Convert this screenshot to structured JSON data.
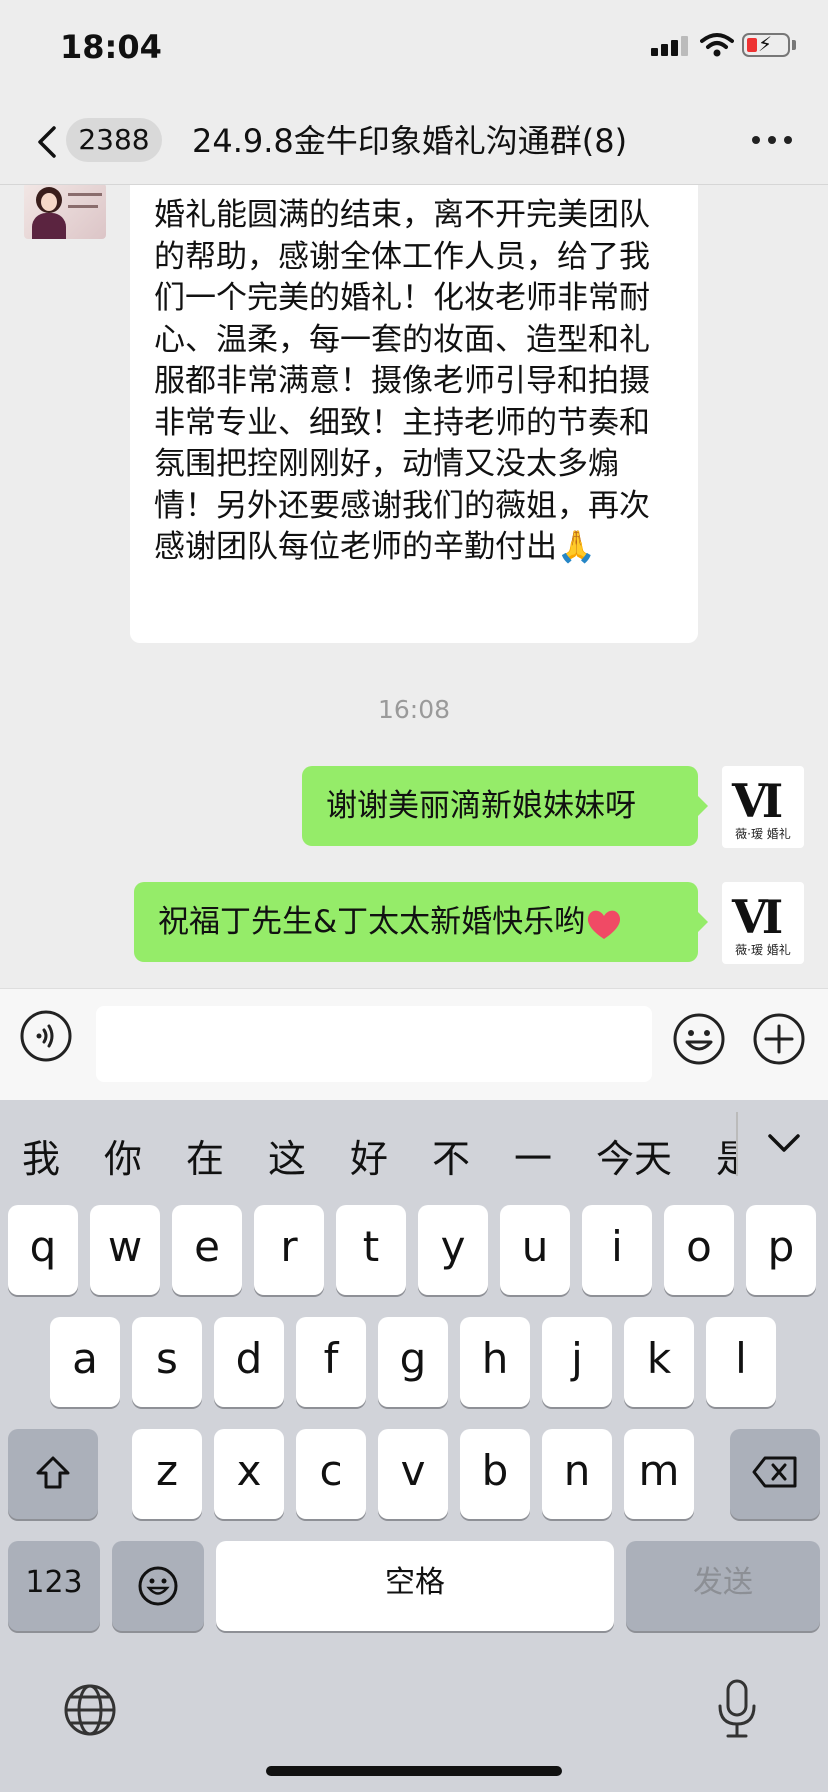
{
  "status_bar": {
    "time": "18:04"
  },
  "header": {
    "unread_count": "2388",
    "title": "24.9.8金牛印象婚礼沟通群(8)"
  },
  "messages": [
    {
      "direction": "in",
      "text": "婚礼能圆满的结束，离不开完美团队的帮助，感谢全体工作人员，给了我们一个完美的婚礼！化妆老师非常耐心、温柔，每一套的妆面、造型和礼服都非常满意！摄像老师引导和拍摄非常专业、细致！主持老师的节奏和氛围把控刚刚好，动情又没太多煽情！另外还要感谢我们的薇姐，再次感谢团队每位老师的辛勤付出🙏"
    },
    {
      "type": "timestamp",
      "text": "16:08"
    },
    {
      "direction": "out",
      "text": "谢谢美丽滴新娘妹妹呀"
    },
    {
      "direction": "out",
      "text": "祝福丁先生&丁太太新婚快乐哟"
    }
  ],
  "sender_avatar": {
    "mark": "VI",
    "caption": "薇·瑷 婚礼"
  },
  "input": {
    "value": ""
  },
  "keyboard": {
    "candidates": [
      "我",
      "你",
      "在",
      "这",
      "好",
      "不",
      "一",
      "今天",
      "是"
    ],
    "row1": [
      "q",
      "w",
      "e",
      "r",
      "t",
      "y",
      "u",
      "i",
      "o",
      "p"
    ],
    "row2": [
      "a",
      "s",
      "d",
      "f",
      "g",
      "h",
      "j",
      "k",
      "l"
    ],
    "row3": [
      "z",
      "x",
      "c",
      "v",
      "b",
      "n",
      "m"
    ],
    "numbers_label": "123",
    "space_label": "空格",
    "send_label": "发送"
  },
  "colors": {
    "outgoing_bubble": "#95ec69",
    "incoming_bubble": "#ffffff",
    "chat_bg": "#ededed",
    "keyboard_bg": "#d1d3d9"
  }
}
